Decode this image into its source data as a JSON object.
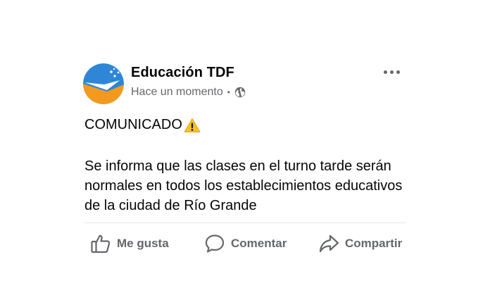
{
  "post": {
    "author": "Educación TDF",
    "timestamp": "Hace un momento",
    "separator": "•",
    "privacy_icon": "globe-icon",
    "headline": "COMUNICADO",
    "headline_icon": "warning-emoji",
    "body": "Se informa que las clases en el turno tarde serán normales en todos los establecimientos educativos de la ciudad de Río Grande"
  },
  "actions": {
    "like_label": "Me gusta",
    "comment_label": "Comentar",
    "share_label": "Compartir"
  },
  "colors": {
    "text_primary": "#050505",
    "text_secondary": "#65676b",
    "divider": "#e4e6eb",
    "avatar_blue": "#2f86d6",
    "avatar_orange": "#f39a1e",
    "warning_yellow": "#f7c325"
  }
}
